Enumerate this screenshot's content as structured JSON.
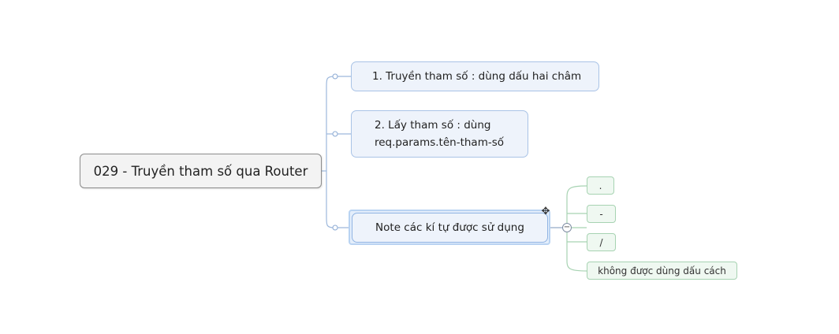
{
  "mindmap": {
    "central_topic": "029 - Truyền tham số qua Router",
    "branches": [
      {
        "label": "1. Truyền tham số : dùng dấu hai châm"
      },
      {
        "line1": "2. Lấy tham số : dùng",
        "line2": "req.params.tên-tham-số"
      },
      {
        "label": "Note các kí tự được sử dụng",
        "children": [
          ".",
          "-",
          "/",
          "không được dùng dấu cách"
        ]
      }
    ],
    "collapse_symbol": "−",
    "move_handle_symbol": "✥"
  },
  "colors": {
    "branch_fill": "#eef3fb",
    "branch_border": "#a9c3e6",
    "leaf_fill": "#eff8f1",
    "leaf_border": "#a7d3b2",
    "selection": "#b9d3f2"
  },
  "icons": {
    "collapse": "collapse-minus-icon",
    "move": "move-arrows-icon"
  }
}
